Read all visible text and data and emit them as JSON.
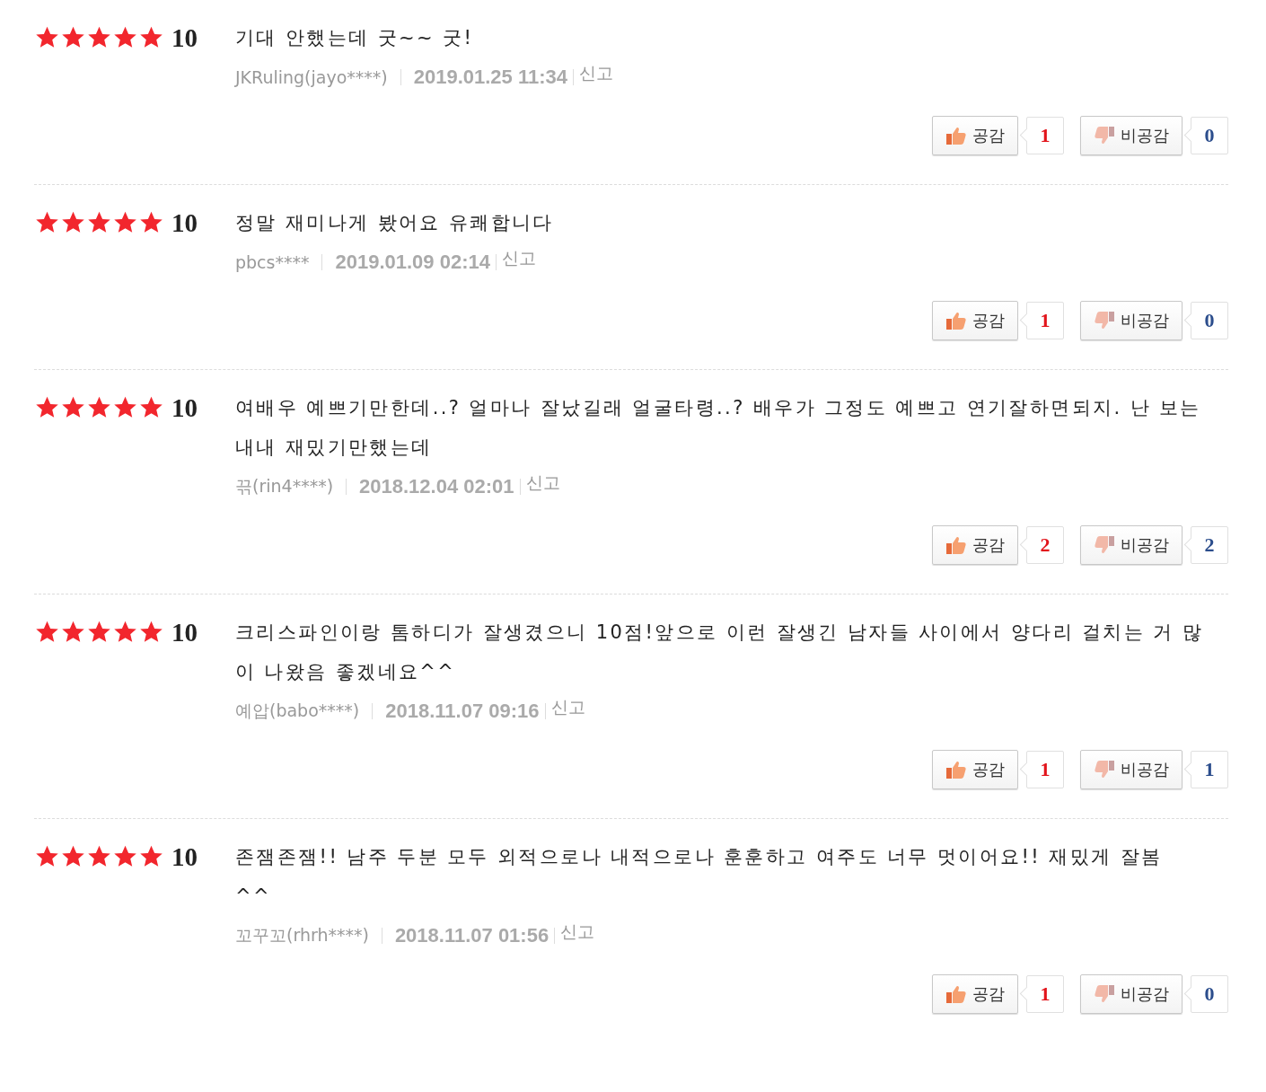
{
  "reviews": [
    {
      "stars": 5,
      "score": "10",
      "text": "기대 안했는데 굿~~ 굿!",
      "author": "JKRuling(jayo****)",
      "date": "2019.01.25 11:34",
      "report": "신고",
      "like": {
        "label": "공감",
        "count": "1"
      },
      "dislike": {
        "label": "비공감",
        "count": "0"
      }
    },
    {
      "stars": 5,
      "score": "10",
      "text": "정말 재미나게 봤어요 유쾌합니다",
      "author": "pbcs****",
      "date": "2019.01.09 02:14",
      "report": "신고",
      "like": {
        "label": "공감",
        "count": "1"
      },
      "dislike": {
        "label": "비공감",
        "count": "0"
      }
    },
    {
      "stars": 5,
      "score": "10",
      "text": "여배우 예쁘기만한데..? 얼마나 잘났길래 얼굴타령..? 배우가 그정도 예쁘고 연기잘하면되지. 난 보는 내내 재밌기만했는데",
      "author": "끆(rin4****)",
      "date": "2018.12.04 02:01",
      "report": "신고",
      "like": {
        "label": "공감",
        "count": "2"
      },
      "dislike": {
        "label": "비공감",
        "count": "2"
      }
    },
    {
      "stars": 5,
      "score": "10",
      "text": "크리스파인이랑 톰하디가 잘생겼으니 10점!앞으로 이런 잘생긴 남자들 사이에서 양다리 걸치는 거 많이 나왔음 좋겠네요^^",
      "author": "예압(babo****)",
      "date": "2018.11.07 09:16",
      "report": "신고",
      "like": {
        "label": "공감",
        "count": "1"
      },
      "dislike": {
        "label": "비공감",
        "count": "1"
      }
    },
    {
      "stars": 5,
      "score": "10",
      "text": "존잼존잼!! 남주 두분 모두 외적으로나 내적으로나 훈훈하고 여주도 너무 멋이어요!! 재밌게 잘봄 ^^",
      "author": "꼬꾸꼬(rhrh****)",
      "date": "2018.11.07 01:56",
      "report": "신고",
      "like": {
        "label": "공감",
        "count": "1"
      },
      "dislike": {
        "label": "비공감",
        "count": "0"
      }
    }
  ]
}
